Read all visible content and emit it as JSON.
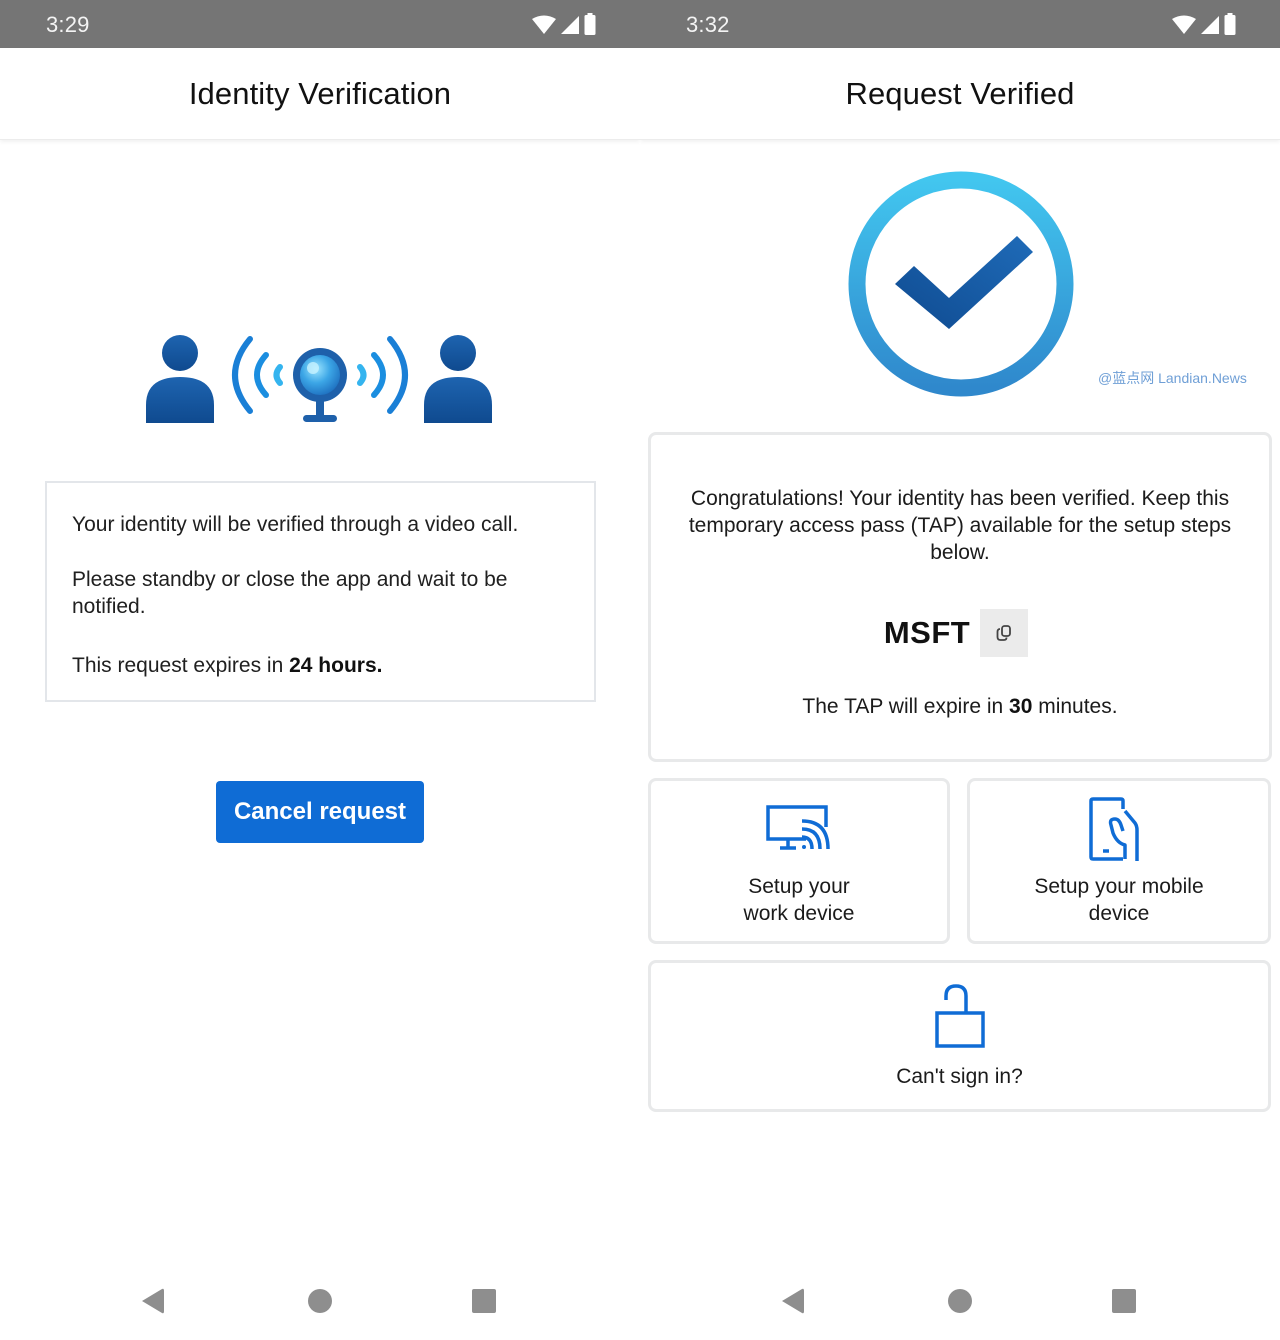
{
  "screens": [
    {
      "status_bar": {
        "time": "3:29",
        "icons": [
          "wifi-icon",
          "cellular-signal-icon",
          "battery-icon"
        ]
      },
      "app_bar": {
        "title": "Identity Verification"
      },
      "hero": {
        "icon": "video-call-identity-illustration"
      },
      "info_box": {
        "line1": "Your identity will be verified through a video call.",
        "line2": "Please standby or close the app and wait to be notified.",
        "line3_prefix": "This request expires in ",
        "line3_bold": "24 hours."
      },
      "cancel_button": {
        "label": "Cancel request",
        "color": "#0f6cd5"
      },
      "nav_bar": {
        "buttons": [
          "back",
          "home",
          "recents"
        ]
      }
    },
    {
      "status_bar": {
        "time": "3:32",
        "icons": [
          "wifi-icon",
          "cellular-signal-icon",
          "battery-icon"
        ]
      },
      "app_bar": {
        "title": "Request Verified"
      },
      "hero": {
        "icon": "checkmark-circle-illustration"
      },
      "watermark": "@蓝点网 Landian.News",
      "tap_card": {
        "message": "Congratulations! Your identity has been verified. Keep this temporary access pass (TAP) available for the setup steps below.",
        "code": "MSFT",
        "copy_icon": "copy-icon",
        "expiry_prefix": "The TAP will expire in ",
        "expiry_bold": "30",
        "expiry_suffix": " minutes."
      },
      "tiles": [
        {
          "id": "work-device",
          "line1": "Setup your",
          "line2": "work device",
          "icon": "monitor-wireless-icon"
        },
        {
          "id": "mobile-device",
          "line1": "Setup your mobile",
          "line2": "device",
          "icon": "phone-hand-icon"
        },
        {
          "id": "cant-sign-in",
          "label": "Can't sign in?",
          "icon": "unlocked-padlock-icon"
        }
      ],
      "accent_color": "#0f6cd5",
      "nav_bar": {
        "buttons": [
          "back",
          "home",
          "recents"
        ]
      }
    }
  ]
}
